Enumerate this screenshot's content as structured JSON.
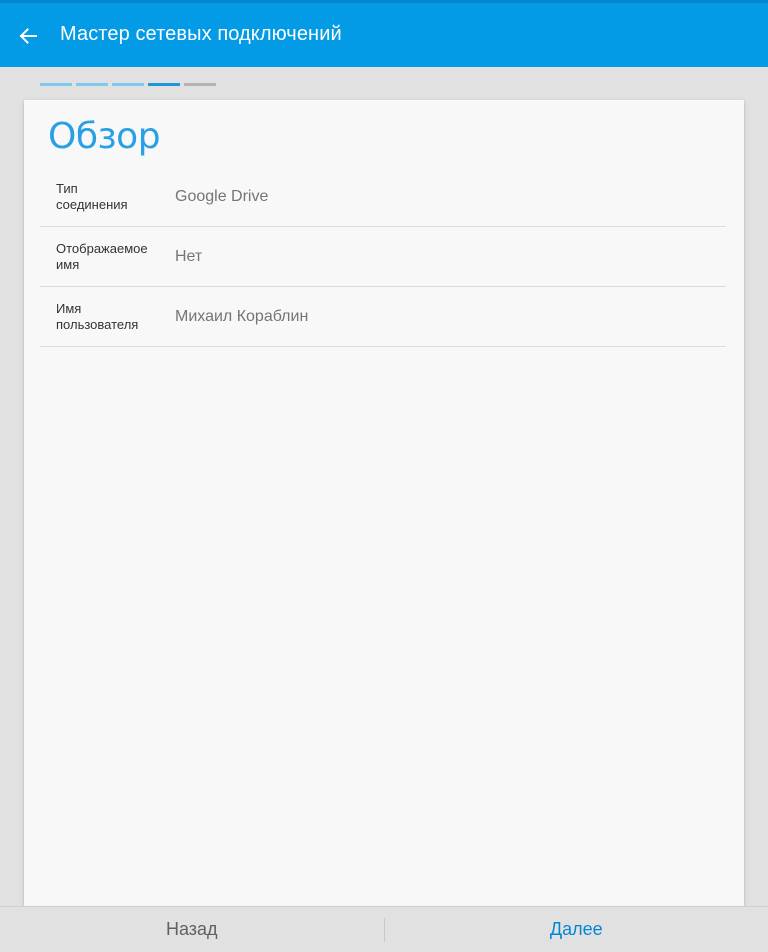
{
  "appbar": {
    "title": "Мастер сетевых подключений",
    "back_icon": "arrow-left-icon"
  },
  "steps": {
    "total": 5,
    "current": 4,
    "colors": {
      "done": "#81c7ee",
      "current": "#1e96d8",
      "pending": "#b4b4b4"
    }
  },
  "card": {
    "title": "Обзор",
    "rows": [
      {
        "label_line1": "Тип",
        "label_line2": "соединения",
        "value": "Google Drive"
      },
      {
        "label_line1": "Отображаемое",
        "label_line2": "имя",
        "value": "Нет"
      },
      {
        "label_line1": "Имя",
        "label_line2": "пользователя",
        "value": "Михаил Кораблин"
      }
    ]
  },
  "bottombar": {
    "back_label": "Назад",
    "next_label": "Далее"
  },
  "colors": {
    "accent": "#039be5",
    "title": "#29a0e6"
  }
}
